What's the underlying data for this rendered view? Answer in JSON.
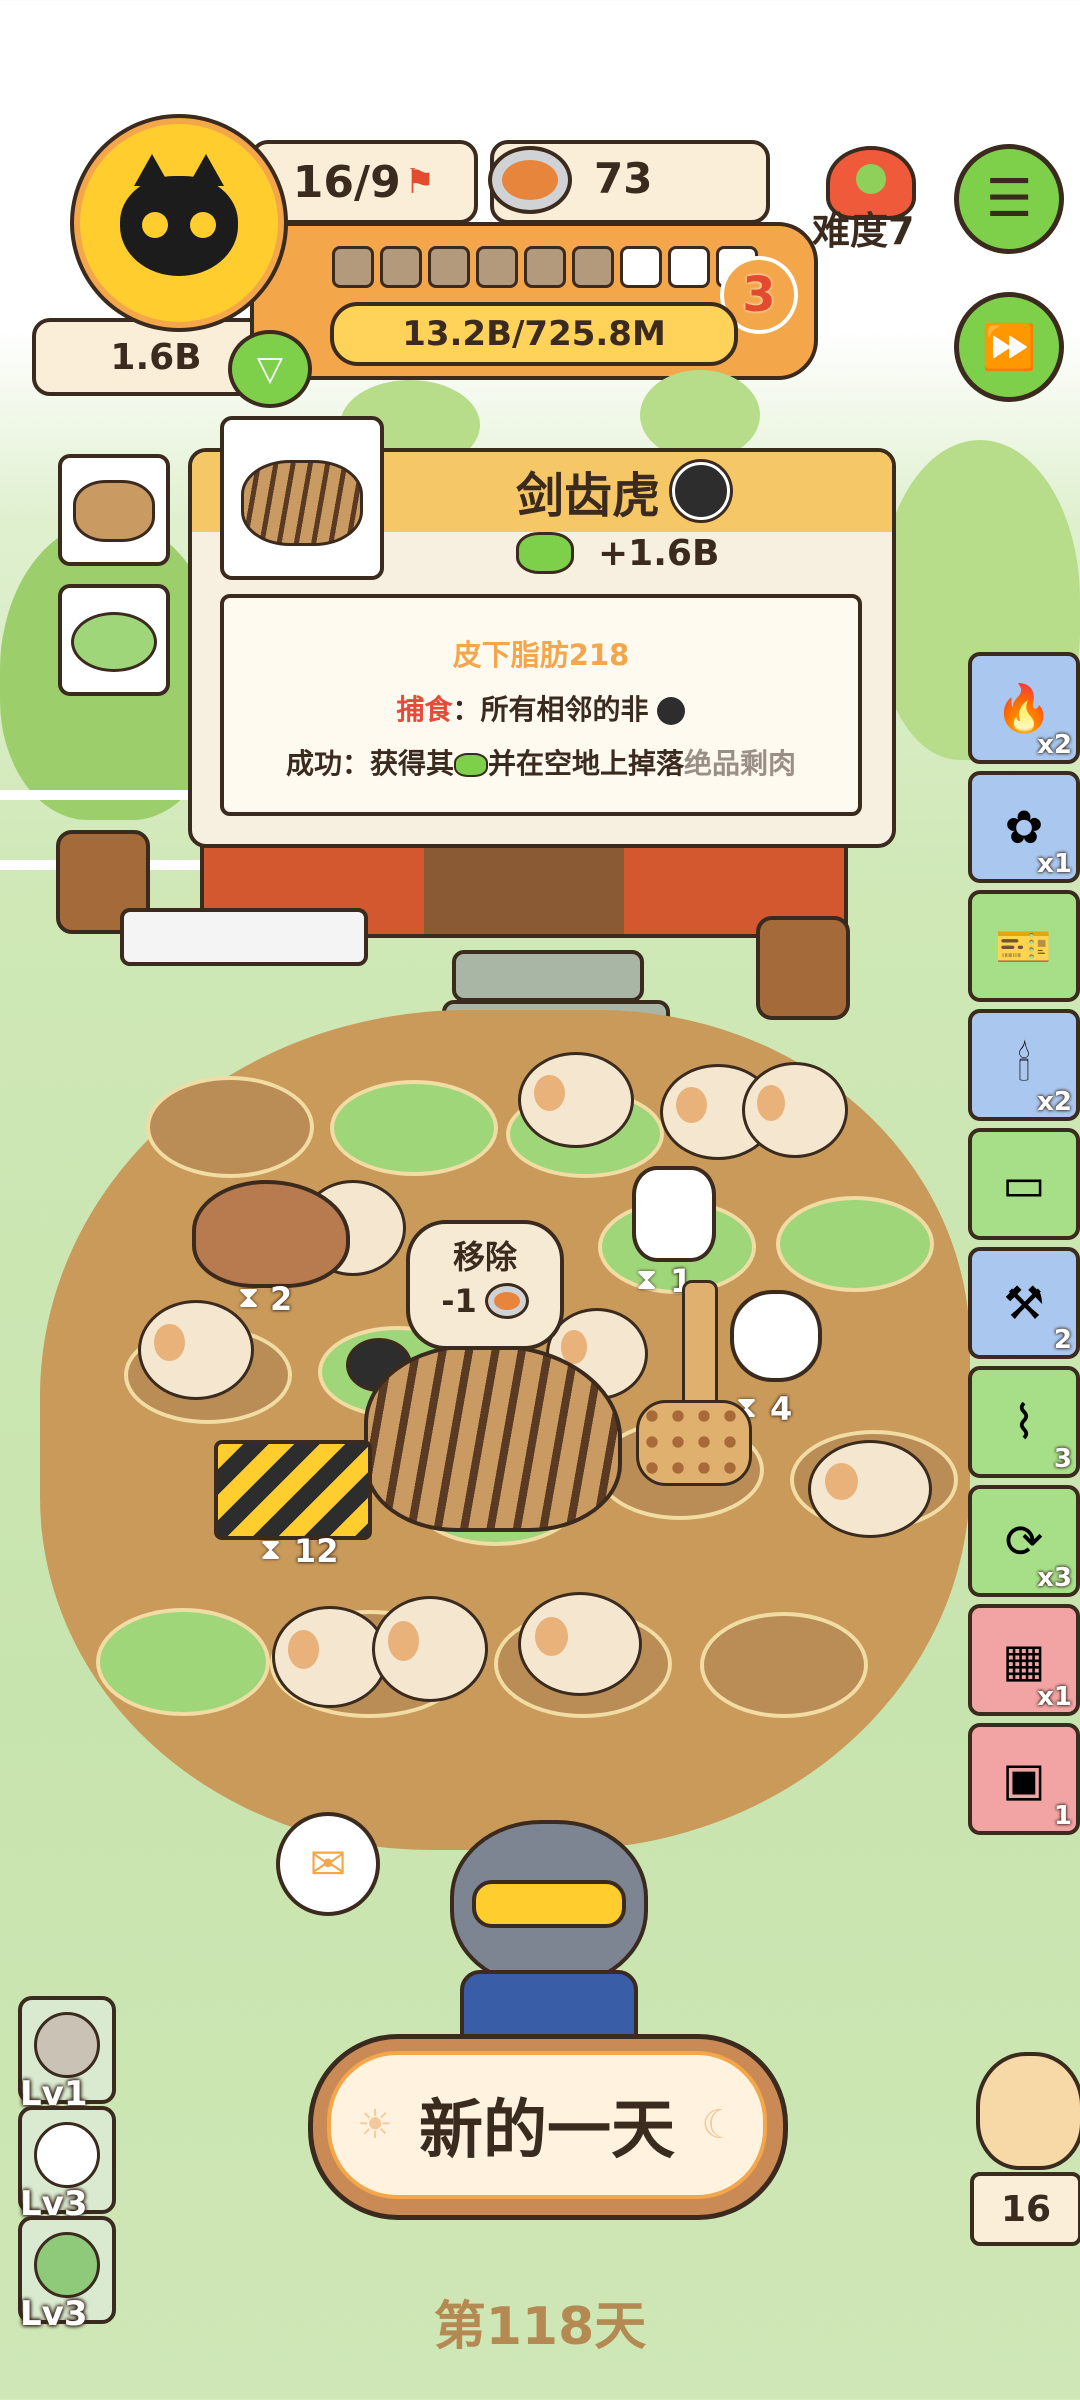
{
  "hud": {
    "capacity": "16/9",
    "food_count": "73",
    "difficulty": "难度7",
    "coins": "1.6B",
    "progress_text": "13.2B/725.8M",
    "level_badge": "3",
    "segments_filled": 6,
    "segments_total": 9
  },
  "popup": {
    "title": "剑齿虎",
    "gain": "+1.6B",
    "trait": "皮下脂肪218",
    "hunt_label": "捕食",
    "hunt_text": "：所有相邻的非",
    "success_label": "成功：获得其",
    "success_text": "并在空地上掉落",
    "success_item": "绝品剩肉"
  },
  "remove_bubble": {
    "title": "移除",
    "cost": "-1"
  },
  "field_counts": {
    "capybara": "2",
    "goat": "1",
    "sheep": "4",
    "barrier": "12"
  },
  "side_items": [
    {
      "icon": "fire-icon",
      "count": "x2",
      "bg": "#a9c7ef"
    },
    {
      "icon": "seed-bag-icon",
      "count": "x1",
      "bg": "#a9c7ef"
    },
    {
      "icon": "ticket-icon",
      "count": "",
      "bg": "#a6df87"
    },
    {
      "icon": "candle-cake-icon",
      "count": "x2",
      "bg": "#a9c7ef"
    },
    {
      "icon": "card-icon",
      "count": "",
      "bg": "#a6df87"
    },
    {
      "icon": "shovel-icon",
      "count": "2",
      "bg": "#a9c7ef"
    },
    {
      "icon": "fence-icon",
      "count": "3",
      "bg": "#a6df87"
    },
    {
      "icon": "coupon-icon",
      "count": "x3",
      "bg": "#a6df87"
    },
    {
      "icon": "grill-icon",
      "count": "x1",
      "bg": "#f2a3a3"
    },
    {
      "icon": "safe-icon",
      "count": "1",
      "bg": "#f2a3a3"
    }
  ],
  "levels": [
    {
      "label": "Lv1",
      "bg": "#c9c2b5"
    },
    {
      "label": "Lv3",
      "bg": "#ffffff"
    },
    {
      "label": "Lv3",
      "bg": "#8fc97a"
    }
  ],
  "owl_count": "16",
  "new_day": "新的一天",
  "day_text": "第118天",
  "colors": {
    "orange": "#f3a64a",
    "panel": "#fbeed9",
    "outline": "#3b2a1e",
    "green_btn": "#7ed04b"
  }
}
